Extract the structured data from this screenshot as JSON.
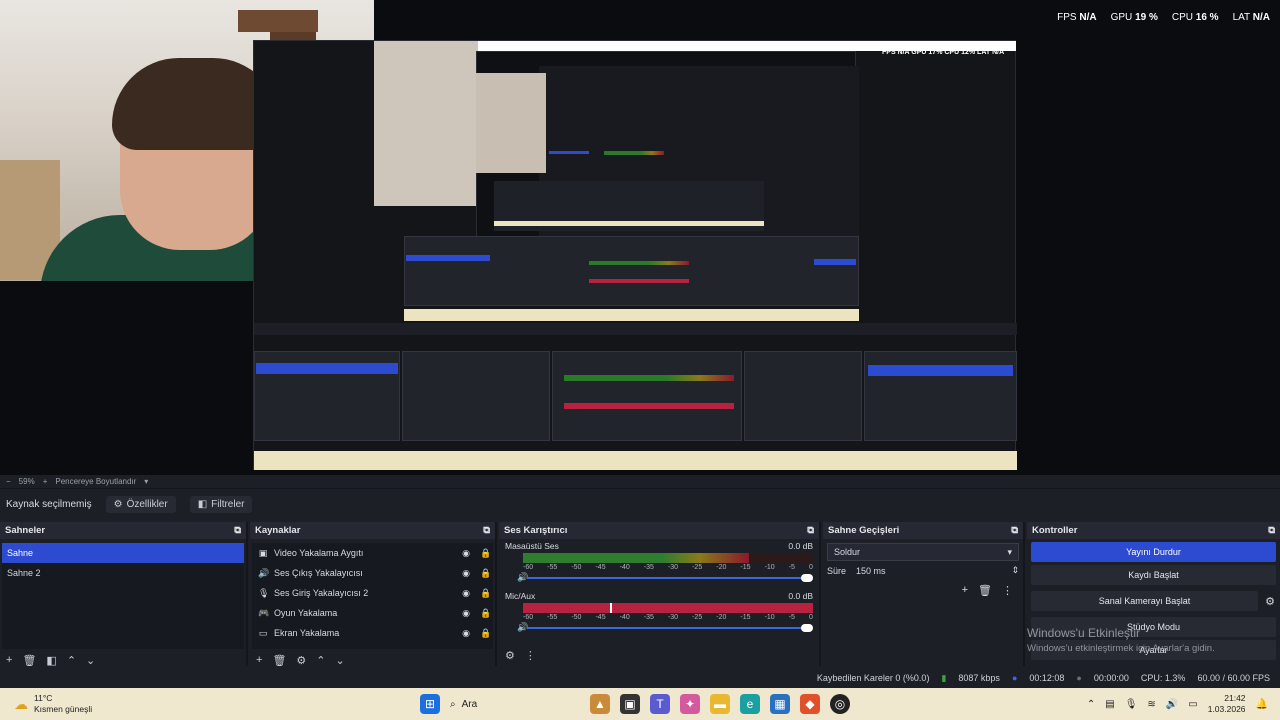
{
  "stats_top": {
    "fps_label": "FPS",
    "fps_value": "N/A",
    "gpu_label": "GPU",
    "gpu_value": "19 %",
    "cpu_label": "CPU",
    "cpu_value": "16 %",
    "lat_label": "LAT",
    "lat_value": "N/A"
  },
  "zoom": {
    "minus": "−",
    "value": "59%",
    "plus": "+",
    "resize_label": "Pencereye Boyutlandır"
  },
  "srcbar": {
    "no_source": "Kaynak seçilmemiş",
    "properties": "Özellikler",
    "filters": "Filtreler"
  },
  "scenes": {
    "title": "Sahneler",
    "items": [
      "Sahne",
      "Sahne 2"
    ]
  },
  "sources": {
    "title": "Kaynaklar",
    "items": [
      "Video Yakalama Aygıtı",
      "Ses Çıkış Yakalayıcısı",
      "Ses Giriş Yakalayıcısı 2",
      "Oyun Yakalama",
      "Ekran Yakalama"
    ]
  },
  "mixer": {
    "title": "Ses Karıştırıcı",
    "channels": [
      {
        "name": "Masaüstü Ses",
        "db": "0.0 dB",
        "level": 0.78,
        "muted_red": false
      },
      {
        "name": "Mic/Aux",
        "db": "0.0 dB",
        "level": 1.0,
        "muted_red": true
      }
    ],
    "ticks": [
      "-60",
      "-55",
      "-50",
      "-45",
      "-40",
      "-35",
      "-30",
      "-25",
      "-20",
      "-15",
      "-10",
      "-5",
      "0"
    ]
  },
  "transitions": {
    "title": "Sahne Geçişleri",
    "selected": "Soldur",
    "duration_label": "Süre",
    "duration_value": "150 ms"
  },
  "controls": {
    "title": "Kontroller",
    "stop_stream": "Yayını Durdur",
    "start_record": "Kaydı Başlat",
    "virtual_cam": "Sanal Kamerayı Başlat",
    "studio_mode": "Stüdyo Modu",
    "settings": "Ayarlar"
  },
  "watermark": {
    "line1": "Windows'u Etkinleştir",
    "line2": "Windows'u etkinleştirmek için Ayarlar'a gidin."
  },
  "bottom_stats": {
    "dropped": "Kaybedilen Kareler 0 (%0.0)",
    "bitrate": "8087 kbps",
    "stream_time": "00:12:08",
    "rec_time": "00:00:00",
    "cpu": "CPU: 1.3%",
    "fps": "60.00 / 60.00 FPS"
  },
  "taskbar": {
    "weather_temp": "11°C",
    "weather_desc": "Kısmen güneşli",
    "search": "Ara",
    "time": "21:42",
    "date": "1.03.2026"
  },
  "colors": {
    "accent": "#2d4bd1",
    "taskbar": "#efe8cf",
    "dock_bg": "#1d1f26",
    "meter_red": "#b8223f"
  }
}
